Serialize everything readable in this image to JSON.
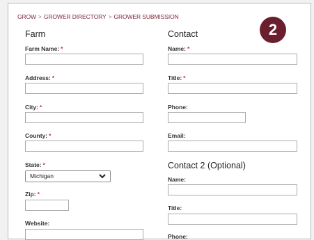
{
  "breadcrumb": {
    "items": [
      "GROW",
      "GROWER DIRECTORY",
      "GROWER SUBMISSION"
    ],
    "separator": ">"
  },
  "step_badge": {
    "number": "2"
  },
  "farm": {
    "title": "Farm",
    "fields": {
      "farm_name": {
        "label": "Farm Name:",
        "required": "*"
      },
      "address": {
        "label": "Address:",
        "required": "*"
      },
      "city": {
        "label": "City:",
        "required": "*"
      },
      "county": {
        "label": "County:",
        "required": "*"
      },
      "state": {
        "label": "State:",
        "required": "*",
        "value": "Michigan"
      },
      "zip": {
        "label": "Zip:",
        "required": "*"
      },
      "website": {
        "label": "Website:"
      }
    }
  },
  "contact": {
    "title": "Contact",
    "fields": {
      "name": {
        "label": "Name:",
        "required": "*"
      },
      "title": {
        "label": "Title:",
        "required": "*"
      },
      "phone": {
        "label": "Phone:"
      },
      "email": {
        "label": "Email:"
      }
    }
  },
  "contact2": {
    "title": "Contact 2 (Optional)",
    "fields": {
      "name": {
        "label": "Name:"
      },
      "title": {
        "label": "Title:"
      },
      "phone": {
        "label": "Phone:"
      }
    }
  },
  "colors": {
    "accent": "#6b1e2e",
    "breadcrumb": "#7a2b3c",
    "required": "#c0392b"
  }
}
